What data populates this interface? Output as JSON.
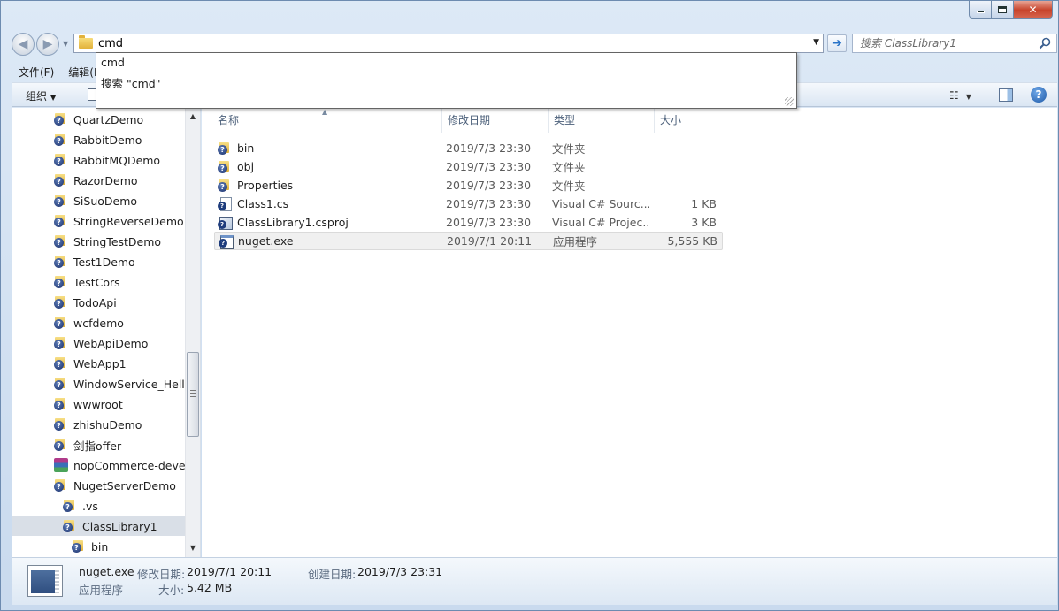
{
  "window": {
    "caption": {
      "min": "",
      "max": "",
      "close": "✕"
    }
  },
  "address_bar": {
    "value": "cmd",
    "search_placeholder": "搜索 ClassLibrary1"
  },
  "autocomplete": {
    "items": [
      "cmd",
      "搜索 \"cmd\""
    ]
  },
  "menu": {
    "items": [
      "文件(F)",
      "编辑(E)"
    ]
  },
  "toolbar": {
    "organize_label": "组织",
    "help_label": "?"
  },
  "nav_tree": {
    "items": [
      {
        "label": "QuartzDemo",
        "icon": "folder-question-icon"
      },
      {
        "label": "RabbitDemo",
        "icon": "folder-question-icon"
      },
      {
        "label": "RabbitMQDemo",
        "icon": "folder-question-icon"
      },
      {
        "label": "RazorDemo",
        "icon": "folder-question-icon"
      },
      {
        "label": "SiSuoDemo",
        "icon": "folder-question-icon"
      },
      {
        "label": "StringReverseDemo",
        "icon": "folder-question-icon"
      },
      {
        "label": "StringTestDemo",
        "icon": "folder-question-icon"
      },
      {
        "label": "Test1Demo",
        "icon": "folder-question-icon"
      },
      {
        "label": "TestCors",
        "icon": "folder-question-icon"
      },
      {
        "label": "TodoApi",
        "icon": "folder-question-icon"
      },
      {
        "label": "wcfdemo",
        "icon": "folder-question-icon"
      },
      {
        "label": "WebApiDemo",
        "icon": "folder-question-icon"
      },
      {
        "label": "WebApp1",
        "icon": "folder-question-icon"
      },
      {
        "label": "WindowService_HelloW",
        "icon": "folder-question-icon"
      },
      {
        "label": "wwwroot",
        "icon": "folder-question-icon"
      },
      {
        "label": "zhishuDemo",
        "icon": "folder-question-icon"
      },
      {
        "label": "剑指offer",
        "icon": "folder-question-icon"
      },
      {
        "label": "nopCommerce-develo",
        "icon": "rar-archive-icon"
      },
      {
        "label": "NugetServerDemo",
        "icon": "folder-question-icon"
      },
      {
        "label": ".vs",
        "icon": "folder-question-icon"
      },
      {
        "label": "ClassLibrary1",
        "icon": "folder-question-icon",
        "selected": true
      },
      {
        "label": "bin",
        "icon": "folder-question-icon"
      }
    ]
  },
  "file_list": {
    "columns": [
      "名称",
      "修改日期",
      "类型",
      "大小"
    ],
    "rows": [
      {
        "name": "bin",
        "date": "2019/7/3 23:30",
        "type": "文件夹",
        "size": "",
        "icon": "folder-question-icon"
      },
      {
        "name": "obj",
        "date": "2019/7/3 23:30",
        "type": "文件夹",
        "size": "",
        "icon": "folder-question-icon"
      },
      {
        "name": "Properties",
        "date": "2019/7/3 23:30",
        "type": "文件夹",
        "size": "",
        "icon": "folder-question-icon"
      },
      {
        "name": "Class1.cs",
        "date": "2019/7/3 23:30",
        "type": "Visual C# Sourc...",
        "size": "1 KB",
        "icon": "csharp-file-icon"
      },
      {
        "name": "ClassLibrary1.csproj",
        "date": "2019/7/3 23:30",
        "type": "Visual C# Projec...",
        "size": "3 KB",
        "icon": "csproj-file-icon"
      },
      {
        "name": "nuget.exe",
        "date": "2019/7/1 20:11",
        "type": "应用程序",
        "size": "5,555 KB",
        "icon": "exe-file-icon",
        "highlighted": true
      }
    ]
  },
  "details": {
    "name": "nuget.exe",
    "modified_label": "修改日期:",
    "modified_value": "2019/7/1 20:11",
    "created_label": "创建日期:",
    "created_value": "2019/7/3 23:31",
    "type": "应用程序",
    "size_label": "大小:",
    "size_value": "5.42 MB"
  }
}
